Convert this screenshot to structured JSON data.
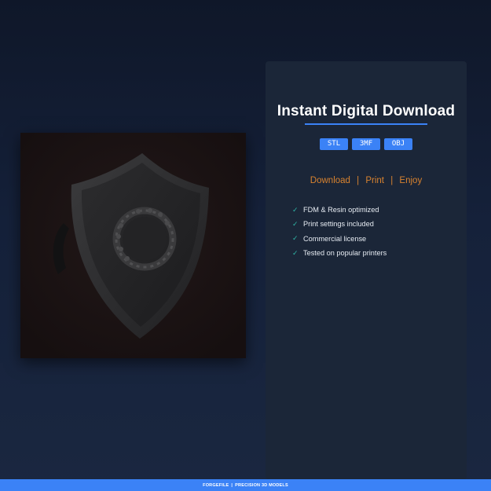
{
  "product": {
    "image_alt": "3D printed shield model render"
  },
  "panel": {
    "title": "Instant Digital Download",
    "formats": [
      "STL",
      "3MF",
      "OBJ"
    ],
    "actions": [
      "Download",
      "Print",
      "Enjoy"
    ],
    "action_separator": "|",
    "features": [
      "FDM & Resin optimized",
      "Print settings included",
      "Commercial license",
      "Tested on popular printers"
    ],
    "check_glyph": "✓"
  },
  "footer": {
    "brand": "FORGEFILE",
    "separator": "|",
    "tagline": "PRECISION 3D MODELS"
  },
  "colors": {
    "accent": "#3b82f6",
    "action_text": "#d9832f",
    "check": "#2fb5a6",
    "panel_bg": "#1b2638"
  }
}
